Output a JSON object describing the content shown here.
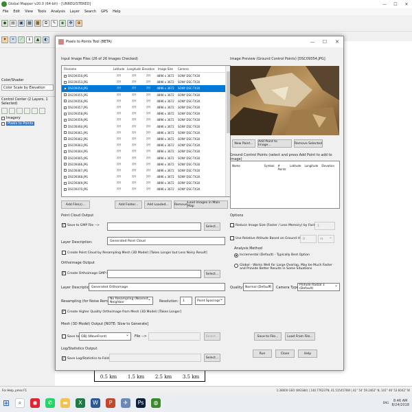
{
  "app": {
    "title": "Global Mapper v20.0 (64-bit) - [UNREGISTERED]",
    "menu": [
      "File",
      "Edit",
      "View",
      "Tools",
      "Analysis",
      "Layer",
      "Search",
      "GPS",
      "Help"
    ],
    "left_panel": {
      "header": "Color/Shader",
      "shader_select": "Color Scale by Elevation",
      "control_center_title": "Control Center (2 Layers, 1 Selected)",
      "layers": [
        {
          "label": "Imagery",
          "selected": false
        },
        {
          "label": "Pixels to Points",
          "selected": true
        }
      ]
    },
    "scale_labels": [
      "0.5 km",
      "1.5 km",
      "2.5 km",
      "3.5 km"
    ],
    "status_left": "For Help, press F1",
    "status_right": "1:38000 GEO (WGS84) | 140.776237N,  41.5154576W | 41° 54' 59.2462\" N,  141° 46' 53.6042\" W"
  },
  "taskbar": {
    "time": "8:46 AM",
    "date": "8/24/2018",
    "lang": "ENG"
  },
  "dialog": {
    "title": "Pixels to Points Tool (BETA)",
    "input_label": "Input Image Files (26 of 26 Images Checked)",
    "columns": [
      "Filename",
      "Latitude",
      "Longitude",
      "Elevation",
      "Image Size",
      "Camera"
    ],
    "rows": [
      {
        "name": "DSC09350.JPG",
        "lat": "???",
        "lon": "???",
        "ele": "???",
        "size": "4896 x 3672",
        "camera": "SONY DSC-TX30",
        "selected": false
      },
      {
        "name": "DSC09353.JPG",
        "lat": "???",
        "lon": "???",
        "ele": "???",
        "size": "4896 x 3672",
        "camera": "SONY DSC-TX30",
        "selected": false
      },
      {
        "name": "DSC09354.JPG",
        "lat": "???",
        "lon": "???",
        "ele": "???",
        "size": "4896 x 3672",
        "camera": "SONY DSC-TX30",
        "selected": true
      },
      {
        "name": "DSC09355.JPG",
        "lat": "???",
        "lon": "???",
        "ele": "???",
        "size": "4896 x 3672",
        "camera": "SONY DSC-TX30",
        "selected": false
      },
      {
        "name": "DSC09356.JPG",
        "lat": "???",
        "lon": "???",
        "ele": "???",
        "size": "4896 x 3672",
        "camera": "SONY DSC-TX30",
        "selected": false
      },
      {
        "name": "DSC09357.JPG",
        "lat": "???",
        "lon": "???",
        "ele": "???",
        "size": "4896 x 3672",
        "camera": "SONY DSC-TX30",
        "selected": false
      },
      {
        "name": "DSC09358.JPG",
        "lat": "???",
        "lon": "???",
        "ele": "???",
        "size": "4896 x 3672",
        "camera": "SONY DSC-TX30",
        "selected": false
      },
      {
        "name": "DSC09359.JPG",
        "lat": "???",
        "lon": "???",
        "ele": "???",
        "size": "4896 x 3672",
        "camera": "SONY DSC-TX30",
        "selected": false
      },
      {
        "name": "DSC09360.JPG",
        "lat": "???",
        "lon": "???",
        "ele": "???",
        "size": "4896 x 3672",
        "camera": "SONY DSC-TX30",
        "selected": false
      },
      {
        "name": "DSC09361.JPG",
        "lat": "???",
        "lon": "???",
        "ele": "???",
        "size": "4896 x 3672",
        "camera": "SONY DSC-TX30",
        "selected": false
      },
      {
        "name": "DSC09362.JPG",
        "lat": "???",
        "lon": "???",
        "ele": "???",
        "size": "4896 x 3672",
        "camera": "SONY DSC-TX30",
        "selected": false
      },
      {
        "name": "DSC09363.JPG",
        "lat": "???",
        "lon": "???",
        "ele": "???",
        "size": "4896 x 3672",
        "camera": "SONY DSC-TX30",
        "selected": false
      },
      {
        "name": "DSC09364.JPG",
        "lat": "???",
        "lon": "???",
        "ele": "???",
        "size": "4896 x 3672",
        "camera": "SONY DSC-TX30",
        "selected": false
      },
      {
        "name": "DSC09365.JPG",
        "lat": "???",
        "lon": "???",
        "ele": "???",
        "size": "4896 x 3672",
        "camera": "SONY DSC-TX30",
        "selected": false
      },
      {
        "name": "DSC09366.JPG",
        "lat": "???",
        "lon": "???",
        "ele": "???",
        "size": "4896 x 3672",
        "camera": "SONY DSC-TX30",
        "selected": false
      },
      {
        "name": "DSC09367.JPG",
        "lat": "???",
        "lon": "???",
        "ele": "???",
        "size": "4896 x 3672",
        "camera": "SONY DSC-TX30",
        "selected": false
      },
      {
        "name": "DSC09368.JPG",
        "lat": "???",
        "lon": "???",
        "ele": "???",
        "size": "4896 x 3672",
        "camera": "SONY DSC-TX30",
        "selected": false
      },
      {
        "name": "DSC09369.JPG",
        "lat": "???",
        "lon": "???",
        "ele": "???",
        "size": "4896 x 3672",
        "camera": "SONY DSC-TX30",
        "selected": false
      },
      {
        "name": "DSC09370.JPG",
        "lat": "???",
        "lon": "???",
        "ele": "???",
        "size": "4896 x 3672",
        "camera": "SONY DSC-TX30",
        "selected": false
      }
    ],
    "list_buttons": {
      "add_files": "Add File(s)...",
      "add_folder": "Add Folder...",
      "add_loaded": "Add Loaded...",
      "remove_selected": "Remove Selected",
      "load_in_map": "Load Images in Main Map"
    },
    "point_cloud": {
      "title": "Point Cloud Output",
      "save_to": "Save to GMP File -->",
      "select": "Select...",
      "layer_desc_label": "Layer Description:",
      "layer_desc_value": "Generated Point Cloud",
      "create_mesh": "Create Point Cloud by Resampling Mesh (3D Model) [Takes Longer but Less Noisy Result]"
    },
    "ortho": {
      "title": "Orthoimage Output",
      "create": "Create Orthoimage GMP File -->",
      "select": "Select...",
      "layer_desc_label": "Layer Description:",
      "layer_desc_value": "Generated Orthoimage",
      "resampling_label": "Resampling (for Noise Removal):",
      "resampling_value": "No Resampling (Nearest Neighbor",
      "resolution_label": "Resolution:",
      "resolution_value": "1",
      "spacing_value": "Point Spacings",
      "higher_quality": "Create Higher Quality Orthoimage from Mesh (3D Model) [Takes Longer]"
    },
    "mesh": {
      "title": "Mesh (3D Model) Output [NOTE: Slow to Generate]",
      "save_to": "Save to",
      "format_value": "OBJ (WaveFront)",
      "file_arrow": "File -->",
      "select": "Select..."
    },
    "log": {
      "title": "Log/Statistics Output",
      "save": "Save Log/Statistics to Folder",
      "select": "Select..."
    },
    "preview_label": "Image Preview (Ground Control Points) [DSC09354.JPG]",
    "preview_buttons": {
      "new_point": "New Point...",
      "add_point": "Add Point to Image...",
      "remove_selected": "Remove Selected"
    },
    "gcp_label": "Ground Control Points (select and press Add Point to add to image)",
    "gcp_columns": [
      "Name",
      "Symbol",
      "# Points",
      "Latitude",
      "Longitude",
      "Elevation"
    ],
    "options": {
      "title": "Options",
      "reduce_size": "Reduce Image Size (Faster / Less Memory) by Factor of",
      "reduce_value": "1",
      "relative_alt": "Use Relative Altitude Based on Ground Height of",
      "relative_value": "0",
      "relative_unit": "m",
      "analysis_title": "Analysis Method",
      "incremental": "Incremental (Default) - Typically Best Option",
      "global": "Global - Works Well for Large Overlap, May be Much Faster and Provide Better Results in Some Situations",
      "quality_label": "Quality:",
      "quality_value": "Normal (Default)",
      "camera_label": "Camera Type:",
      "camera_value": "Pinhole Radial 3 (Default)"
    },
    "bottom_buttons": {
      "save_file": "Save to File...",
      "load_file": "Load From File...",
      "run": "Run",
      "close": "Close",
      "help": "Help"
    }
  },
  "icons": [
    "globe-logo-icon",
    "minimize-icon",
    "maximize-icon",
    "close-icon",
    "windows-start-icon",
    "chrome-icon",
    "whatsapp-icon",
    "folder-icon",
    "excel-icon",
    "word-icon",
    "powerpoint-icon",
    "photoshop-icon",
    "global-mapper-icon"
  ],
  "colors": {
    "selection": "#0078d7",
    "dialog_bg": "#f0f0f0"
  }
}
